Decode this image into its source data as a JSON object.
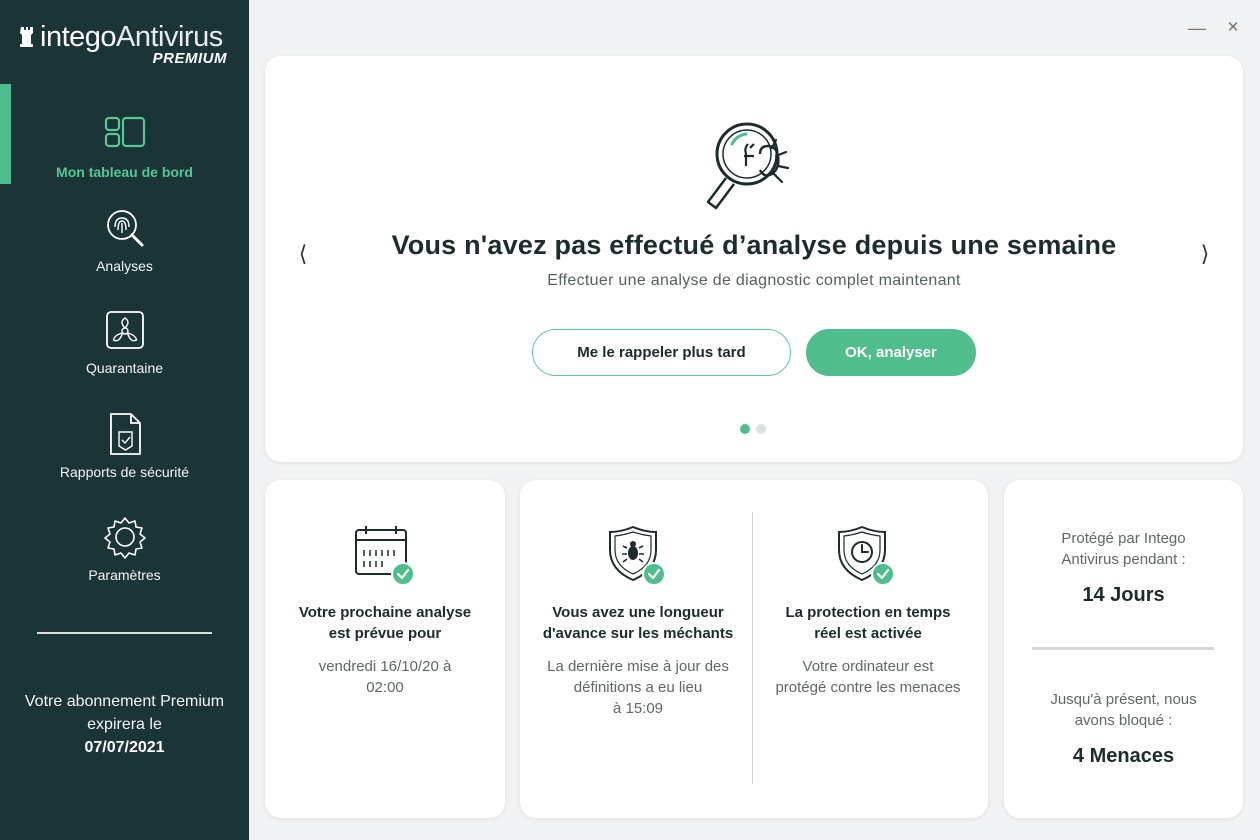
{
  "app": {
    "logo_brand": "intego",
    "logo_product": "Antivirus",
    "logo_edition": "PREMIUM"
  },
  "sidebar": {
    "items": [
      {
        "label": "Mon tableau de bord",
        "icon": "dashboard-icon",
        "active": true
      },
      {
        "label": "Analyses",
        "icon": "fingerprint-scan-icon",
        "active": false
      },
      {
        "label": "Quarantaine",
        "icon": "biohazard-icon",
        "active": false
      },
      {
        "label": "Rapports de sécurité",
        "icon": "report-document-icon",
        "active": false
      },
      {
        "label": "Paramètres",
        "icon": "gear-icon",
        "active": false
      }
    ],
    "subscription_line1": "Votre abonnement Premium",
    "subscription_line2": "expirera le",
    "subscription_date": "07/07/2021"
  },
  "window": {
    "minimize": "—",
    "close": "✕"
  },
  "hero": {
    "icon": "magnifier-bug-icon",
    "title": "Vous n'avez pas effectué d’analyse depuis une semaine",
    "subtitle": "Effectuer une analyse de diagnostic complet maintenant",
    "prev_arrow": "⟨",
    "next_arrow": "⟩",
    "secondary_button": "Me le rappeler plus tard",
    "primary_button": "OK, analyser",
    "slide_count": 2,
    "active_slide": 1
  },
  "cards": {
    "next_scan": {
      "icon": "calendar-check-icon",
      "title_line1": "Votre prochaine analyse",
      "title_line2": "est prévue pour",
      "desc_line1": "vendredi 16/10/20 à",
      "desc_line2": "02:00"
    },
    "definitions": {
      "icon": "shield-bug-check-icon",
      "title_line1": "Vous avez une longueur",
      "title_line2": "d'avance sur les méchants",
      "desc_line1": "La dernière mise à jour des",
      "desc_line2": "définitions a eu lieu",
      "desc_line3": "à 15:09"
    },
    "realtime": {
      "icon": "shield-clock-check-icon",
      "title_line1": "La protection en temps",
      "title_line2": "réel est activée",
      "desc_line1": "Votre ordinateur est",
      "desc_line2": "protégé contre les menaces"
    },
    "stats": {
      "protected_label_line1": "Protégé par Intego",
      "protected_label_line2": "Antivirus pendant :",
      "protected_value": "14 Jours",
      "blocked_label_line1": "Jusqu'à présent, nous",
      "blocked_label_line2": "avons bloqué :",
      "blocked_value": "4 Menaces"
    }
  },
  "colors": {
    "sidebar_bg": "#1b3436",
    "accent": "#4fbd8d",
    "background": "#f1f2f3"
  }
}
